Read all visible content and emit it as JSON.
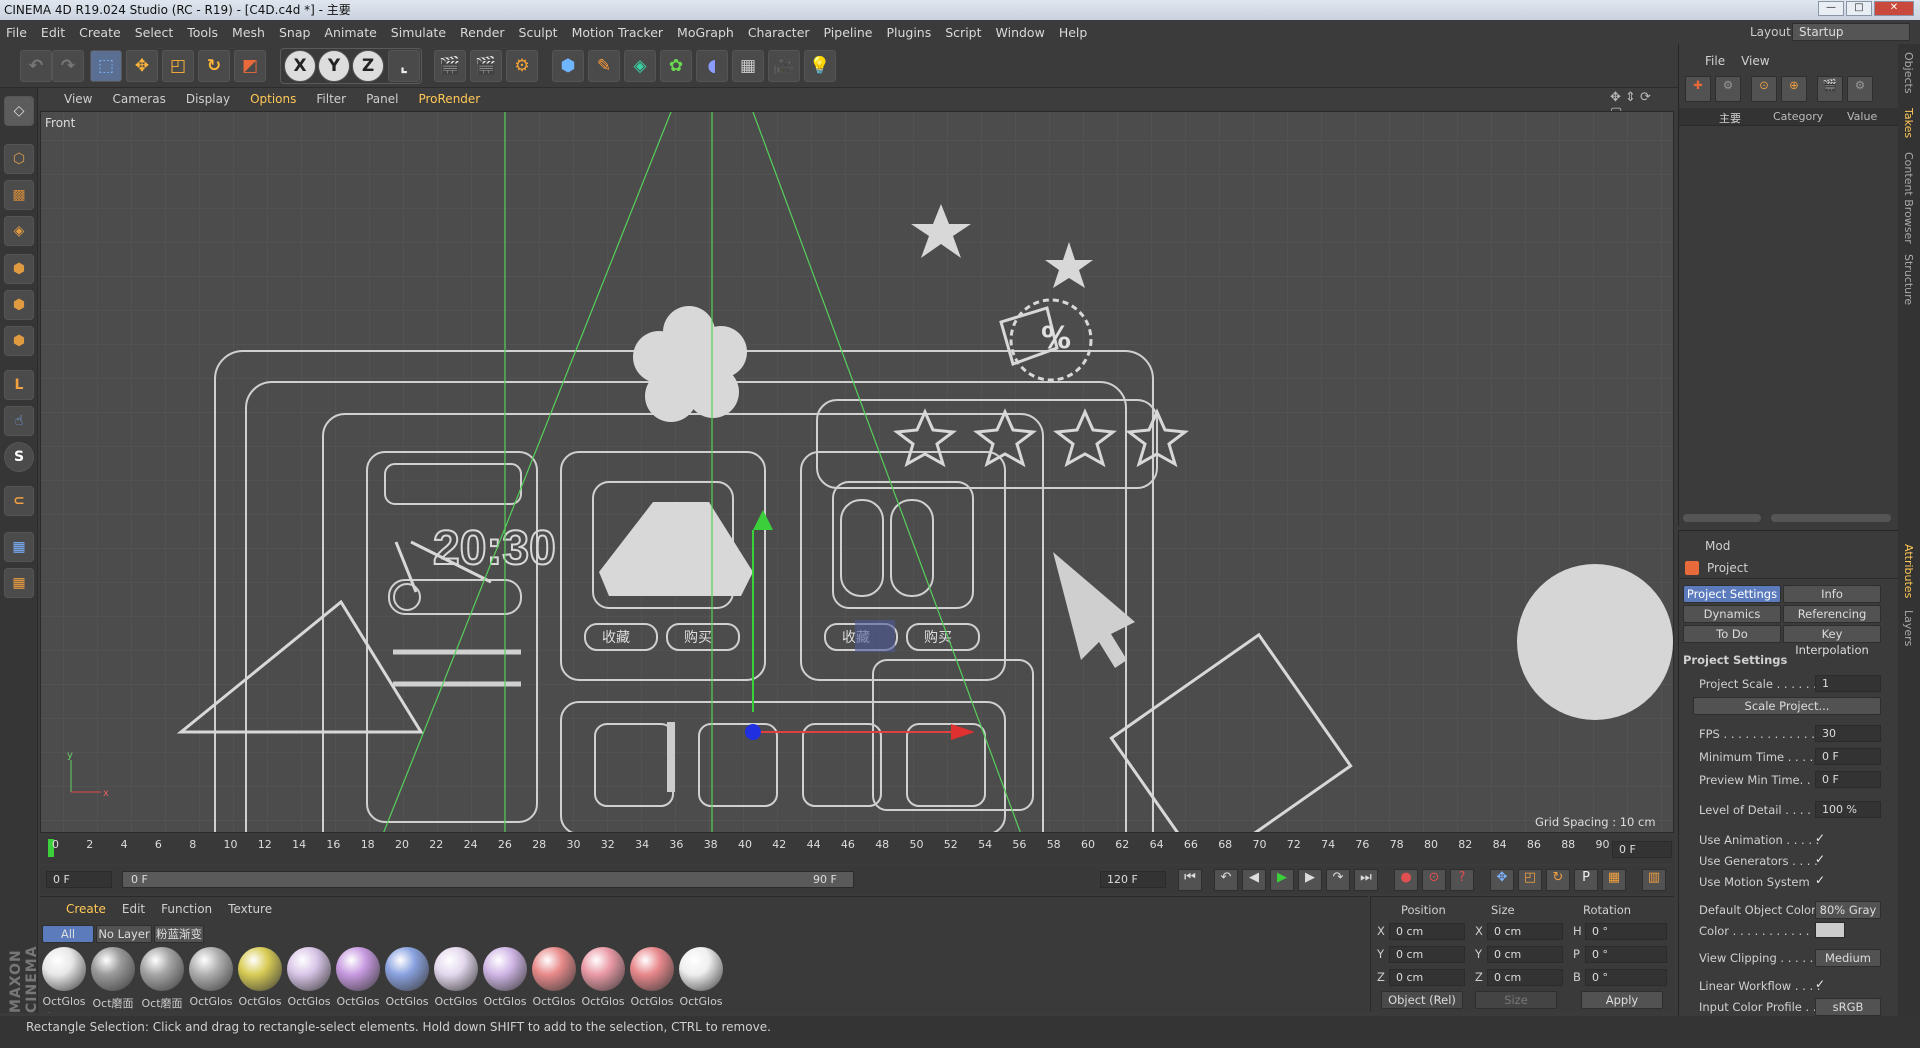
{
  "window": {
    "title": "CINEMA 4D R19.024 Studio (RC - R19) - [C4D.c4d *] - 主要",
    "min": "—",
    "max": "□",
    "close": "✕"
  },
  "menu": [
    "File",
    "Edit",
    "Create",
    "Select",
    "Tools",
    "Mesh",
    "Snap",
    "Animate",
    "Simulate",
    "Render",
    "Sculpt",
    "Motion Tracker",
    "MoGraph",
    "Character",
    "Pipeline",
    "Plugins",
    "Script",
    "Window",
    "Help"
  ],
  "layout": {
    "label": "Layout:",
    "value": "Startup"
  },
  "toolbar": {
    "x": "X",
    "y": "Y",
    "z": "Z"
  },
  "viewport": {
    "menu": [
      "View",
      "Cameras",
      "Display",
      "Options",
      "Filter",
      "Panel",
      "ProRender"
    ],
    "name": "Front",
    "grid_spacing": "Grid Spacing : 10 cm",
    "clock": "20:30",
    "btn_shoucang": "收藏",
    "btn_goumai": "购买",
    "percent": "%",
    "axis_y": "y",
    "axis_x": "x"
  },
  "timeline": {
    "ticks": [
      "0",
      "2",
      "4",
      "6",
      "8",
      "10",
      "12",
      "14",
      "16",
      "18",
      "20",
      "22",
      "24",
      "26",
      "28",
      "30",
      "32",
      "34",
      "36",
      "38",
      "40",
      "42",
      "44",
      "46",
      "48",
      "50",
      "52",
      "54",
      "56",
      "58",
      "60",
      "62",
      "64",
      "66",
      "68",
      "70",
      "72",
      "74",
      "76",
      "78",
      "80",
      "82",
      "84",
      "86",
      "88",
      "90"
    ],
    "current_frame": "0 F",
    "start": "0 F",
    "range_start": "0 F",
    "range_end": "90 F",
    "end": "120 F"
  },
  "materials": {
    "menu": [
      "Create",
      "Edit",
      "Function",
      "Texture"
    ],
    "tabs": [
      "All",
      "No Layer",
      "粉蓝渐变"
    ],
    "items": [
      {
        "label": "OctGlos",
        "color": "#e8e8e8"
      },
      {
        "label": "Oct磨面",
        "color": "#9a9a9a"
      },
      {
        "label": "Oct磨面",
        "color": "#a5a5a5"
      },
      {
        "label": "OctGlos",
        "color": "#b0b0b0"
      },
      {
        "label": "OctGlos",
        "color": "#d8cc55"
      },
      {
        "label": "OctGlos",
        "color": "#d9c6e8"
      },
      {
        "label": "OctGlos",
        "color": "#c79ae0"
      },
      {
        "label": "OctGlos",
        "color": "#8aa2e0"
      },
      {
        "label": "OctGlos",
        "color": "#e4d8ee"
      },
      {
        "label": "OctGlos",
        "color": "#d0b6e6"
      },
      {
        "label": "OctGlos",
        "color": "#e88a8a"
      },
      {
        "label": "OctGlos",
        "color": "#ea9aa6"
      },
      {
        "label": "OctGlos",
        "color": "#e8888c"
      },
      {
        "label": "OctGlos",
        "color": "#efefef"
      }
    ]
  },
  "coords": {
    "headers": [
      "Position",
      "Size",
      "Rotation"
    ],
    "rows": [
      {
        "axis": "X",
        "pos": "0 cm",
        "saxis": "X",
        "size": "0 cm",
        "raxis": "H",
        "rot": "0 °"
      },
      {
        "axis": "Y",
        "pos": "0 cm",
        "saxis": "Y",
        "size": "0 cm",
        "raxis": "P",
        "rot": "0 °"
      },
      {
        "axis": "Z",
        "pos": "0 cm",
        "saxis": "Z",
        "size": "0 cm",
        "raxis": "B",
        "rot": "0 °"
      }
    ],
    "mode": "Object (Rel)",
    "size_mode": "Size",
    "apply": "Apply"
  },
  "objects": {
    "menu": [
      "File",
      "View"
    ],
    "root": "主要",
    "col_category": "Category",
    "col_value": "Value"
  },
  "attributes": {
    "mode": "Mod",
    "title": "Project",
    "tabs": [
      "Project Settings",
      "Info",
      "Dynamics",
      "Referencing",
      "To Do",
      "Key Interpolation"
    ],
    "section": "Project Settings",
    "project_scale_label": "Project Scale . . . . . .",
    "project_scale": "1",
    "scale_btn": "Scale Project...",
    "fps_label": "FPS . . . . . . . . . . . . . . .",
    "fps": "30",
    "min_time_label": "Minimum Time . . . . .",
    "min_time": "0 F",
    "prev_min_label": "Preview Min Time. . .",
    "prev_min": "0 F",
    "lod_label": "Level of Detail . . . . . .",
    "lod": "100 %",
    "use_anim": "Use Animation . . . . .",
    "use_gen": "Use Generators . . . .",
    "use_motion": "Use Motion System",
    "def_color_label": "Default Object Color",
    "def_color": "80% Gray",
    "color_label": "Color . . . . . . . . . . .",
    "clip_label": "View Clipping . . . . . .",
    "clip": "Medium",
    "linear_label": "Linear Workflow . . . .",
    "input_label": "Input Color Profile . . .",
    "input": "sRGB",
    "check": "✓"
  },
  "side_tabs": [
    "Objects",
    "Takes",
    "Content Browser",
    "Structure",
    "Attributes",
    "Layers"
  ],
  "status": "Rectangle Selection: Click and drag to rectangle-select elements. Hold down SHIFT to add to the selection, CTRL to remove.",
  "brand": "MAXON CINEMA 4D"
}
